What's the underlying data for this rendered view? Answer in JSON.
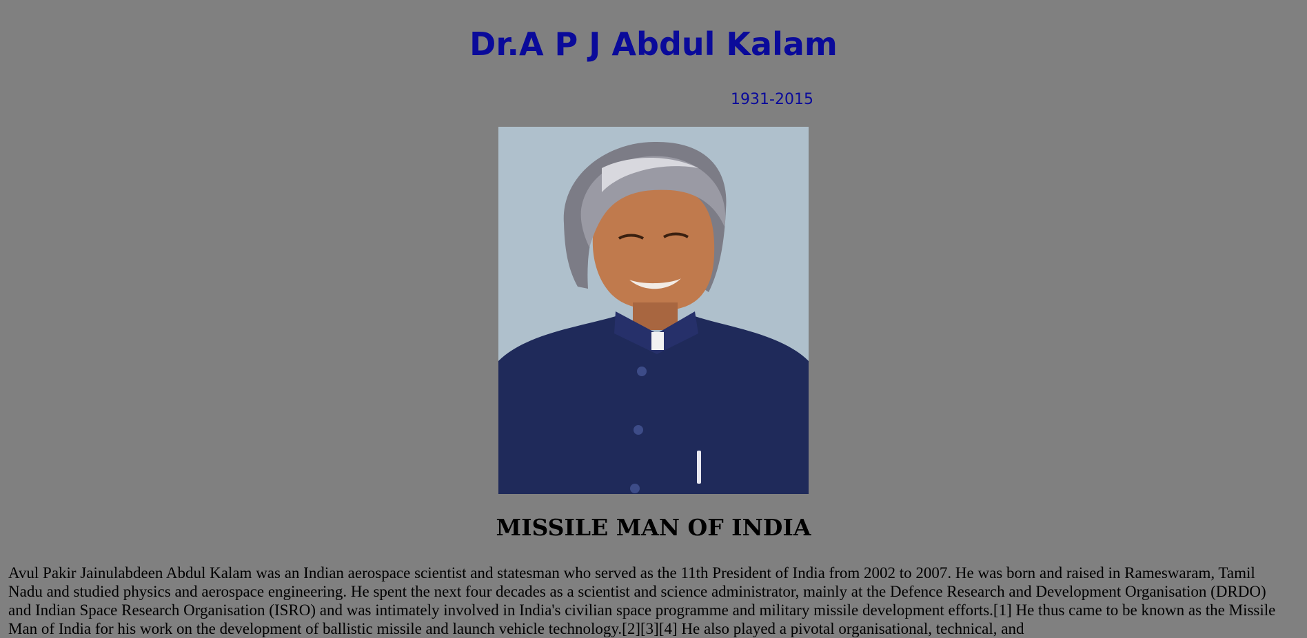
{
  "header": {
    "title": "Dr.A P J Abdul Kalam",
    "years": "1931-2015"
  },
  "portrait": {
    "icon": "portrait-photo",
    "background_color": "#aebfcb",
    "suit_color": "#1f2a5a"
  },
  "section": {
    "heading": "MISSILE MAN OF INDIA",
    "paragraph": "Avul Pakir Jainulabdeen Abdul Kalam was an Indian aerospace scientist and statesman who served as the 11th President of India from 2002 to 2007. He was born and raised in Rameswaram, Tamil Nadu and studied physics and aerospace engineering. He spent the next four decades as a scientist and science administrator, mainly at the Defence Research and Development Organisation (DRDO) and Indian Space Research Organisation (ISRO) and was intimately involved in India's civilian space programme and military missile development efforts.[1] He thus came to be known as the Missile Man of India for his work on the development of ballistic missile and launch vehicle technology.[2][3][4] He also played a pivotal organisational, technical, and"
  },
  "theme": {
    "page_background": "#808080",
    "title_color": "#0a0a9a",
    "text_color": "#000000"
  }
}
